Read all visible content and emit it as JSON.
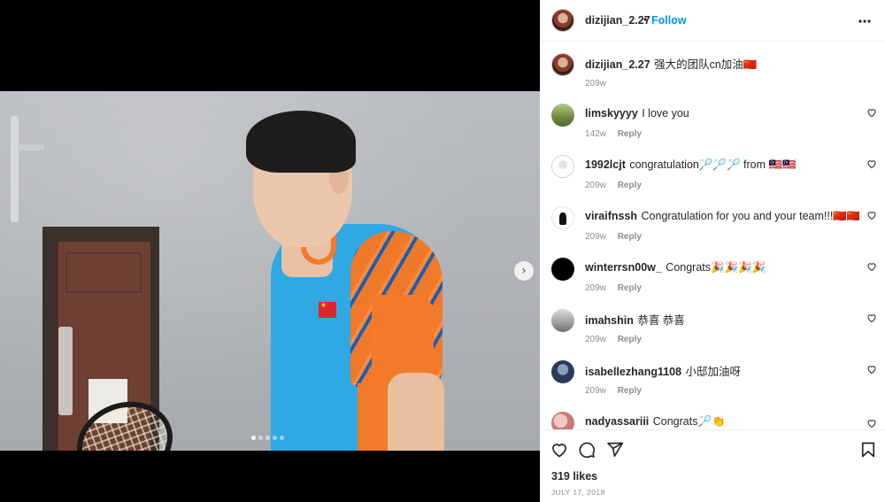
{
  "post": {
    "author": "dizijian_2.27",
    "follow_label": "Follow",
    "header_separator": "•",
    "more_label": "•••",
    "caption": "强大的团队cn加油🇨🇳",
    "caption_time": "209w",
    "carousel": {
      "slides": 5,
      "active": 0,
      "next_label": "›"
    },
    "likes": "319 likes",
    "date": "JULY 17, 2018"
  },
  "comments": [
    {
      "user": "limskyyyy",
      "text": "I love you",
      "time": "142w",
      "reply": "Reply"
    },
    {
      "user": "1992lcjt",
      "text": "congratulation🏸🏸🏸 from 🇲🇾🇲🇾",
      "time": "209w",
      "reply": "Reply"
    },
    {
      "user": "viraifnssh",
      "text": "Congratulation for you and your team!!!🇨🇳🇨🇳cn",
      "time": "209w",
      "reply": "Reply"
    },
    {
      "user": "winterrsn00w_",
      "text": "Congrats🎉🎉🎉🎉",
      "time": "209w",
      "reply": "Reply"
    },
    {
      "user": "imahshin",
      "text": "恭喜 恭喜",
      "time": "209w",
      "reply": "Reply"
    },
    {
      "user": "isabellezhang1108",
      "text": "小邸加油呀",
      "time": "209w",
      "reply": "Reply"
    },
    {
      "user": "nadyassariii",
      "text": "Congrats🏸👏",
      "time": "",
      "reply": ""
    }
  ],
  "icons": {
    "like": "heart-icon",
    "comment": "comment-icon",
    "share": "paper-plane-icon",
    "save": "bookmark-icon",
    "next": "chevron-right-icon",
    "more": "more-horizontal-icon"
  },
  "colors": {
    "follow": "#0095f6",
    "text": "#262626",
    "muted": "#8e8e8e"
  }
}
